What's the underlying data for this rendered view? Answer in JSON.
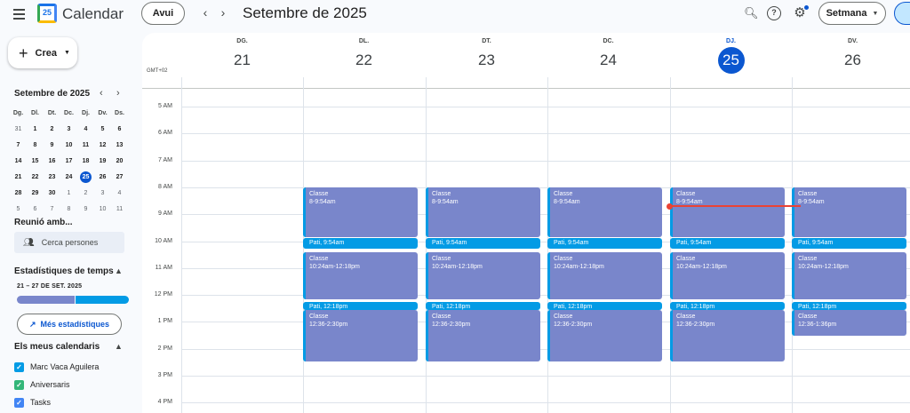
{
  "header": {
    "title": "Calendar",
    "logo_day": "25",
    "today_label": "Avui",
    "period": "Setembre de 2025",
    "view_label": "Setmana"
  },
  "sidebar": {
    "create_label": "Crea",
    "mini_month": "Setembre de 2025",
    "mini_dow": [
      "Dg.",
      "Dl.",
      "Dt.",
      "Dc.",
      "Dj.",
      "Dv.",
      "Ds."
    ],
    "mini_weeks": [
      [
        "31",
        "1",
        "2",
        "3",
        "4",
        "5",
        "6"
      ],
      [
        "7",
        "8",
        "9",
        "10",
        "11",
        "12",
        "13"
      ],
      [
        "14",
        "15",
        "16",
        "17",
        "18",
        "19",
        "20"
      ],
      [
        "21",
        "22",
        "23",
        "24",
        "25",
        "26",
        "27"
      ],
      [
        "28",
        "29",
        "30",
        "1",
        "2",
        "3",
        "4"
      ],
      [
        "5",
        "6",
        "7",
        "8",
        "9",
        "10",
        "11"
      ]
    ],
    "meet_title": "Reunió amb...",
    "search_people": "Cerca persones",
    "stats_title": "Estadístiques de temps",
    "stats_range": "21 – 27 DE SET. 2025",
    "more_stats": "Més estadístiques",
    "my_cals_title": "Els meus calendaris",
    "calendars": [
      {
        "name": "Marc Vaca Aguilera",
        "color": "#039be5"
      },
      {
        "name": "Aniversaris",
        "color": "#33b679"
      },
      {
        "name": "Tasks",
        "color": "#4285f4"
      }
    ]
  },
  "grid": {
    "timezone": "GMT+02",
    "days": [
      {
        "dow": "DG.",
        "num": "21",
        "current": false
      },
      {
        "dow": "DL.",
        "num": "22",
        "current": false
      },
      {
        "dow": "DT.",
        "num": "23",
        "current": false
      },
      {
        "dow": "DC.",
        "num": "24",
        "current": false
      },
      {
        "dow": "DJ.",
        "num": "25",
        "current": true
      },
      {
        "dow": "DV.",
        "num": "26",
        "current": false
      }
    ],
    "hours": [
      "5 AM",
      "6 AM",
      "7 AM",
      "8 AM",
      "9 AM",
      "10 AM",
      "11 AM",
      "12 PM",
      "1 PM",
      "2 PM",
      "3 PM",
      "4 PM"
    ],
    "events": [
      {
        "title": "Classe",
        "time": "8-9:54am",
        "start": 8.0,
        "end": 9.9,
        "days": [
          1,
          2,
          3,
          4,
          5
        ],
        "kind": "class"
      },
      {
        "title": "Pati",
        "time": "9:54am",
        "start": 9.9,
        "end": 10.3,
        "days": [
          1,
          2,
          3,
          4,
          5
        ],
        "kind": "task"
      },
      {
        "title": "Classe",
        "time": "10:24am-12:18pm",
        "start": 10.4,
        "end": 12.2,
        "days": [
          1,
          2,
          3,
          4,
          5
        ],
        "kind": "class"
      },
      {
        "title": "Pati",
        "time": "12:18pm",
        "start": 12.25,
        "end": 12.5,
        "days": [
          1,
          2,
          3,
          4,
          5
        ],
        "kind": "task"
      },
      {
        "title": "Classe",
        "time": "12:36-2:30pm",
        "start": 12.55,
        "end": 14.5,
        "days": [
          1,
          2,
          3,
          4
        ],
        "kind": "class"
      },
      {
        "title": "Classe",
        "time": "12:36-1:36pm",
        "start": 12.55,
        "end": 13.55,
        "days": [
          5
        ],
        "kind": "class"
      }
    ],
    "now": {
      "day": 4,
      "hour": 8.7
    }
  },
  "colors": {
    "accent": "#0b57d0",
    "class_event": "#7986cb",
    "task_event": "#039be5",
    "now": "#ea4335"
  }
}
